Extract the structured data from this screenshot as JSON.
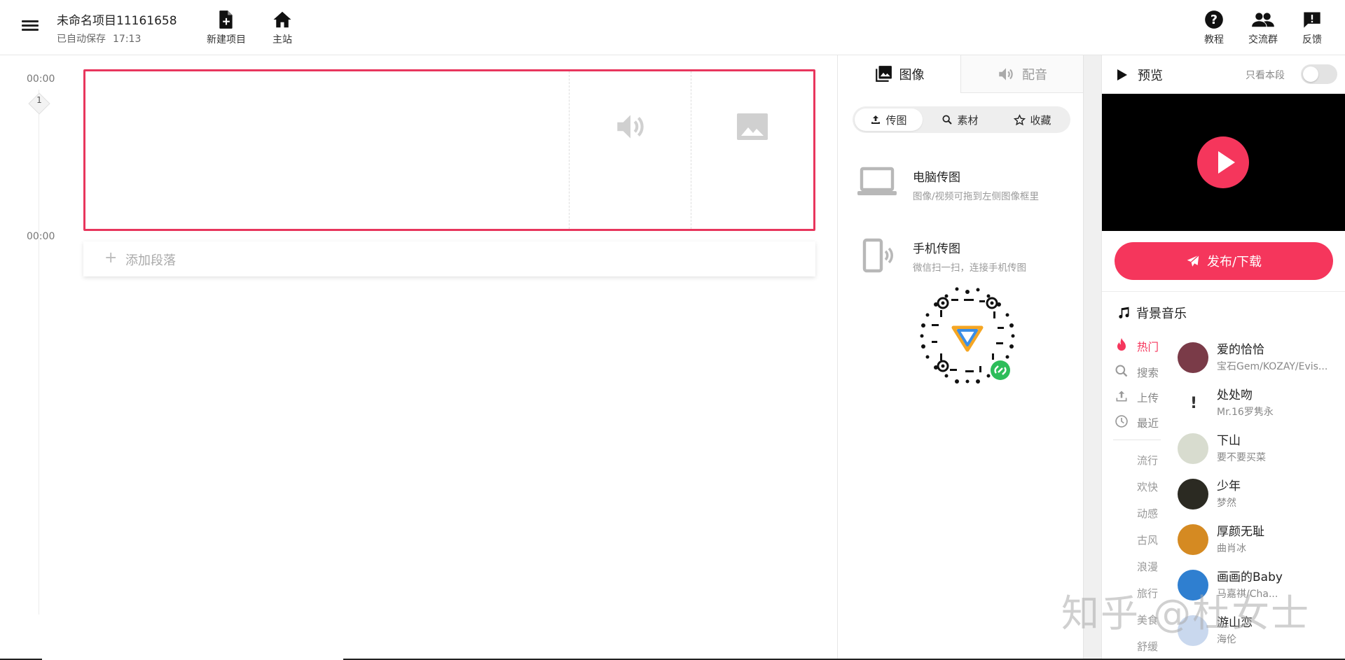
{
  "header": {
    "project_title": "未命名项目11161658",
    "autosave_label": "已自动保存",
    "autosave_time": "17:13",
    "new_project": "新建项目",
    "home": "主站",
    "tutorial": "教程",
    "community": "交流群",
    "feedback": "反馈"
  },
  "timeline": {
    "start_time": "00:00",
    "end_time": "00:00",
    "segment_number": "1",
    "add_segment": "添加段落"
  },
  "media_panel": {
    "tabs": [
      "图像",
      "配音"
    ],
    "active_tab": "图像",
    "sub_tabs": [
      "传图",
      "素材",
      "收藏"
    ],
    "active_sub_tab": "传图",
    "pc_upload": {
      "title": "电脑传图",
      "desc": "图像/视频可拖到左侧图像框里"
    },
    "phone_upload": {
      "title": "手机传图",
      "desc": "微信扫一扫，连接手机传图"
    }
  },
  "preview": {
    "title": "预览",
    "only_segment": "只看本段",
    "only_segment_on": false,
    "publish": "发布/下载"
  },
  "bgm": {
    "title": "背景音乐",
    "categories": [
      "热门",
      "搜索",
      "上传",
      "最近"
    ],
    "active_category": "热门",
    "genres": [
      "流行",
      "欢快",
      "动感",
      "古风",
      "浪漫",
      "旅行",
      "美食",
      "舒缓"
    ],
    "songs": [
      {
        "name": "爱的恰恰",
        "artist": "宝石Gem/KOZAY/Evis...",
        "color": "#7a3b48"
      },
      {
        "name": "处处吻",
        "artist": "Mr.16罗隽永",
        "color": "#ffffff"
      },
      {
        "name": "下山",
        "artist": "要不要买菜",
        "color": "#d8dccf"
      },
      {
        "name": "少年",
        "artist": "梦然",
        "color": "#2b2a22"
      },
      {
        "name": "厚颜无耻",
        "artist": "曲肖冰",
        "color": "#d58a22"
      },
      {
        "name": "画画的Baby",
        "artist": "马嘉祺/Cha...",
        "color": "#2f7fd0"
      },
      {
        "name": "游山恋",
        "artist": "海伦",
        "color": "#c9d8ee"
      }
    ]
  },
  "watermark": "知乎 @杜女士",
  "colors": {
    "accent": "#f5365c",
    "selected_border": "#e8365d"
  }
}
